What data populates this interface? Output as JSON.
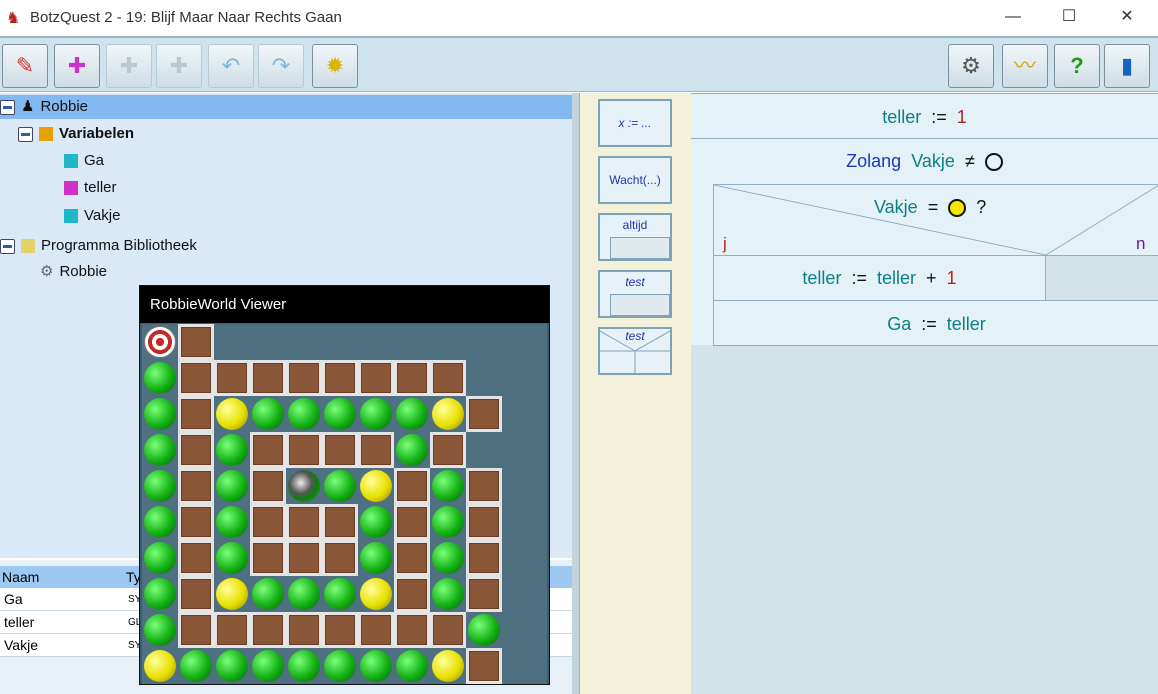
{
  "window": {
    "title": "BotzQuest 2 - 19: Blijf Maar Naar Rechts Gaan",
    "minimize": "—",
    "maximize": "☐",
    "close": "✕"
  },
  "tree": {
    "root": "Robbie",
    "variables_header": "Variabelen",
    "variables": [
      "Ga",
      "teller",
      "Vakje"
    ],
    "library": "Programma Bibliotheek",
    "library_item": "Robbie"
  },
  "props": {
    "col_name": "Naam",
    "col_type": "Ty",
    "rows": [
      {
        "name": "Ga",
        "type": "SY"
      },
      {
        "name": "teller",
        "type": "GL"
      },
      {
        "name": "Vakje",
        "type": "SY"
      }
    ]
  },
  "palette": {
    "assign": "x := ...",
    "wait": "Wacht(...)",
    "always": "altijd",
    "test1": "test",
    "test2": "test"
  },
  "editor": {
    "line1": {
      "var": "teller",
      "op": ":=",
      "val": "1"
    },
    "loop": {
      "kw": "Zolang",
      "var": "Vakje",
      "op": "≠"
    },
    "cond": {
      "var": "Vakje",
      "op": "=",
      "q": "?",
      "yes": "j",
      "no": "n"
    },
    "then": {
      "var": "teller",
      "op": ":=",
      "var2": "teller",
      "plus": "+",
      "val": "1"
    },
    "last": {
      "var": "Ga",
      "op": ":=",
      "val": "teller"
    }
  },
  "viewer": {
    "title": "RobbieWorld Viewer",
    "grid": [
      "T#........",
      "G########.",
      "G#YGGGGGY#",
      "G#G####G#.",
      "G#G#RGY#G#",
      "G#G###G#G#",
      "G#G###G#G#",
      "G#YGGGY#G#",
      "G########G",
      "YGGGGGGGY#"
    ]
  }
}
